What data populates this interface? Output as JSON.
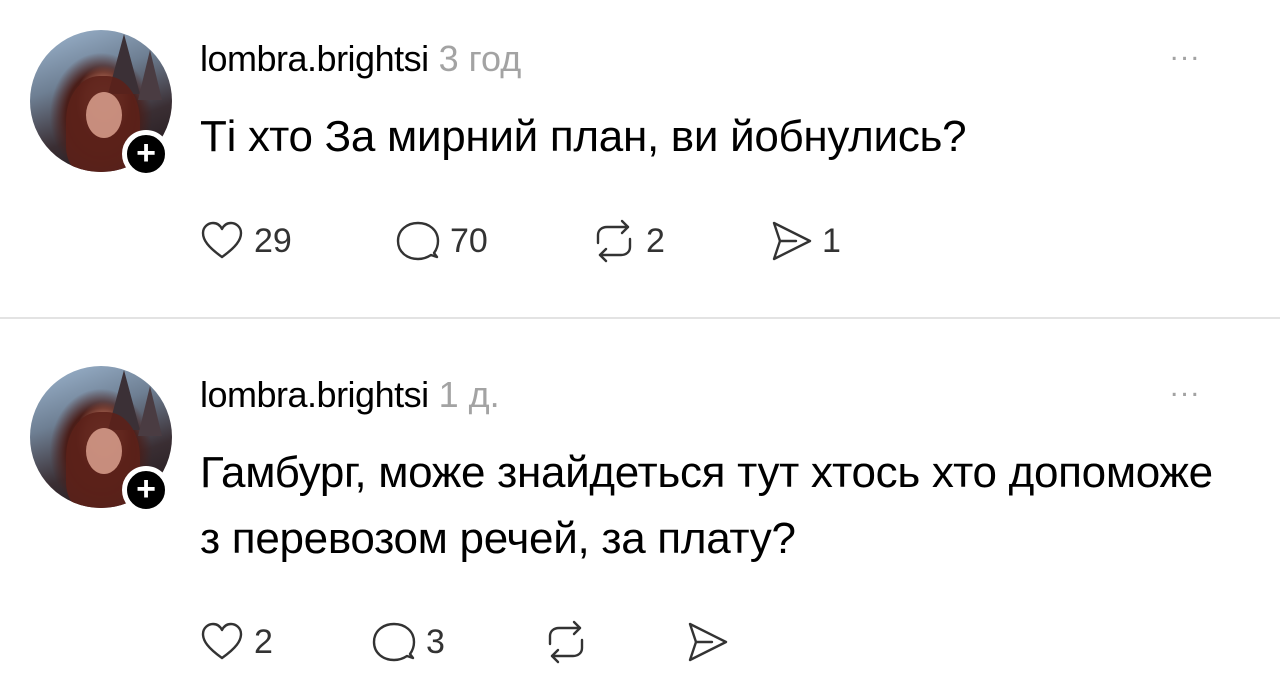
{
  "posts": [
    {
      "username": "lombra.brightsi",
      "time": "3 год",
      "more": "...",
      "follow_symbol": "+",
      "text": "Ті хто За мирний план, ви йобнулись?",
      "likes": "29",
      "replies": "70",
      "reposts": "2",
      "shares": "1"
    },
    {
      "username": "lombra.brightsi",
      "time": "1 д.",
      "more": "...",
      "follow_symbol": "+",
      "text": "Гамбург, може знайдеться тут хтось хто допоможе з перевозом речей, за плату?",
      "likes": "2",
      "replies": "3",
      "reposts": "",
      "shares": ""
    }
  ],
  "icons": {
    "like": "heart-icon",
    "reply": "comment-icon",
    "repost": "repost-icon",
    "share": "send-icon",
    "more": "more-options-icon"
  },
  "colors": {
    "text": "#000000",
    "muted": "#a3a3a3",
    "icon": "#333333",
    "divider": "#e3e3e3"
  }
}
